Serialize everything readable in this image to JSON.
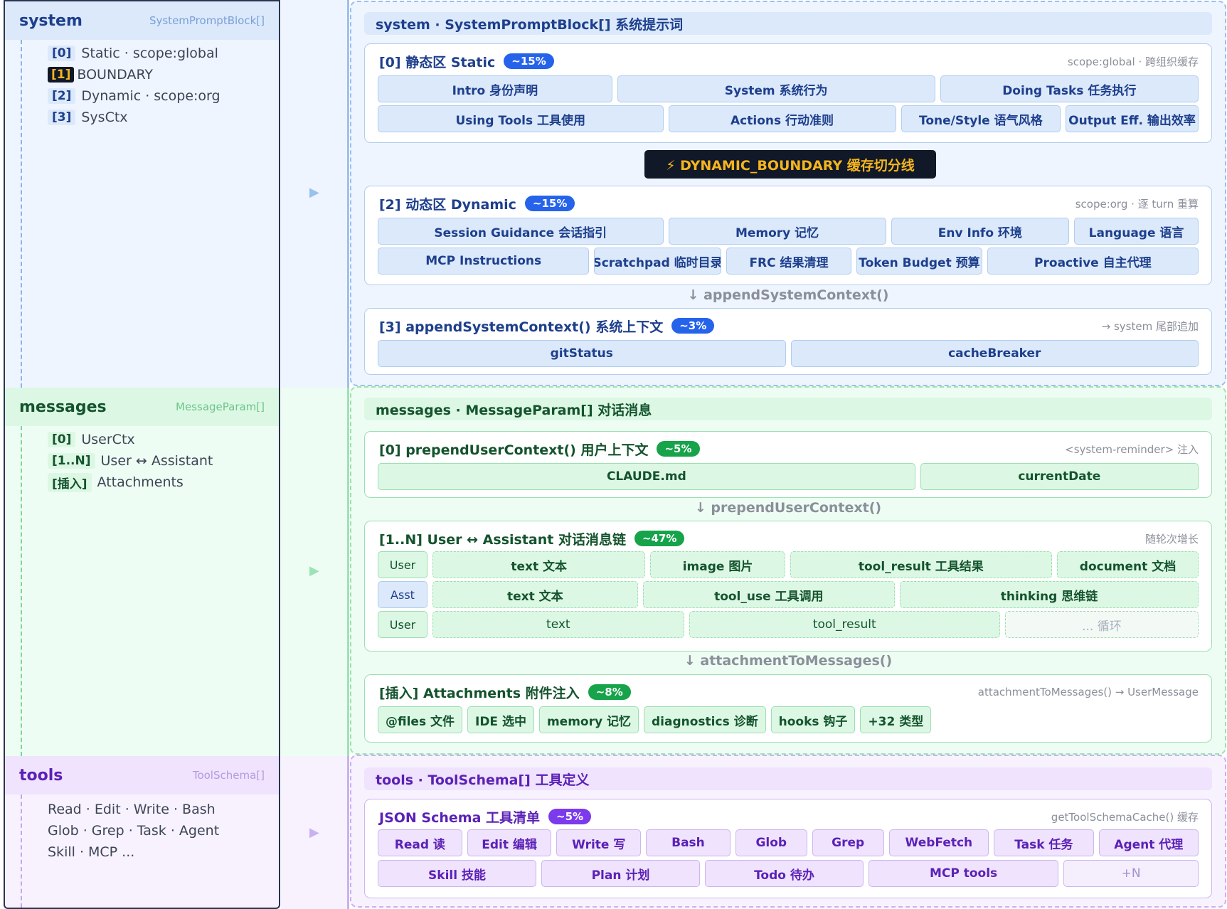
{
  "left": {
    "system": {
      "title": "system",
      "type": "SystemPromptBlock[]",
      "rows": [
        {
          "idx": "[0]",
          "text": "Static · scope:global"
        },
        {
          "idx": "[1]",
          "text": "BOUNDARY"
        },
        {
          "idx": "[2]",
          "text": "Dynamic · scope:org"
        },
        {
          "idx": "[3]",
          "text": "SysCtx"
        }
      ]
    },
    "messages": {
      "title": "messages",
      "type": "MessageParam[]",
      "rows": [
        {
          "idx": "[0]",
          "text": "UserCtx"
        },
        {
          "idx": "[1..N]",
          "text": "User ↔ Assistant"
        },
        {
          "idx": "[插入]",
          "text": "Attachments"
        }
      ]
    },
    "tools": {
      "title": "tools",
      "type": "ToolSchema[]",
      "lines": [
        "Read · Edit · Write · Bash",
        "Glob · Grep · Task · Agent",
        "Skill · MCP ..."
      ]
    }
  },
  "arrow_glyph": "▶",
  "system": {
    "title": "system · SystemPromptBlock[] 系统提示词",
    "static": {
      "title": "[0] 静态区 Static",
      "badge": "~15%",
      "note": "scope:global · 跨组织缓存",
      "row1": [
        "Intro 身份声明",
        "System 系统行为",
        "Doing Tasks 任务执行"
      ],
      "row2": [
        "Using Tools 工具使用",
        "Actions 行动准则",
        "Tone/Style 语气风格",
        "Output Eff. 输出效率"
      ]
    },
    "boundary": "⚡ DYNAMIC_BOUNDARY 缓存切分线",
    "dynamic": {
      "title": "[2] 动态区 Dynamic",
      "badge": "~15%",
      "note": "scope:org · 逐 turn 重算",
      "row1": [
        "Session Guidance 会话指引",
        "Memory 记忆",
        "Env Info 环境",
        "Language 语言"
      ],
      "row2": [
        "MCP Instructions",
        "Scratchpad 临时目录",
        "FRC 结果清理",
        "Token Budget 预算",
        "Proactive 自主代理"
      ]
    },
    "connector": "↓ appendSystemContext()",
    "sysctx": {
      "title": "[3] appendSystemContext() 系统上下文",
      "badge": "~3%",
      "note": "→ system 尾部追加",
      "items": [
        "gitStatus",
        "cacheBreaker"
      ]
    }
  },
  "messages": {
    "title": "messages · MessageParam[] 对话消息",
    "userctx": {
      "title": "[0] prependUserContext() 用户上下文",
      "badge": "~5%",
      "note": "<system-reminder> 注入",
      "items": [
        "CLAUDE.md",
        "currentDate"
      ]
    },
    "connector1": "↓ prependUserContext()",
    "chain": {
      "title": "[1..N] User ↔ Assistant 对话消息链",
      "badge": "~47%",
      "note": "随轮次增长",
      "row1": {
        "role": "User",
        "items": [
          "text 文本",
          "image 图片",
          "tool_result 工具结果",
          "document 文档"
        ]
      },
      "row2": {
        "role": "Asst",
        "items": [
          "text 文本",
          "tool_use 工具调用",
          "thinking 思维链"
        ]
      },
      "row3": {
        "role": "User",
        "items": [
          "text",
          "tool_result",
          "... 循环"
        ]
      }
    },
    "connector2": "↓ attachmentToMessages()",
    "attach": {
      "title": "[插入] Attachments 附件注入",
      "badge": "~8%",
      "note": "attachmentToMessages() → UserMessage",
      "items": [
        "@files 文件",
        "IDE 选中",
        "memory 记忆",
        "diagnostics 诊断",
        "hooks 钩子",
        "+32 类型"
      ]
    }
  },
  "tools": {
    "title": "tools · ToolSchema[] 工具定义",
    "schema": {
      "title": "JSON Schema 工具清单",
      "badge": "~5%",
      "note": "getToolSchemaCache() 缓存",
      "row1": [
        "Read 读",
        "Edit 编辑",
        "Write 写",
        "Bash",
        "Glob",
        "Grep",
        "WebFetch",
        "Task 任务",
        "Agent 代理"
      ],
      "row2": [
        "Skill 技能",
        "Plan 计划",
        "Todo 待办",
        "MCP tools",
        "+N"
      ]
    }
  },
  "colors": {
    "system_bg": "#eef5ff",
    "system_accent": "#1e3f8c",
    "system_badge": "#2563eb",
    "messages_bg": "#eefdf3",
    "messages_accent": "#14532d",
    "messages_badge": "#16a34a",
    "tools_bg": "#f8f2ff",
    "tools_accent": "#5b21b6",
    "tools_badge": "#7c3aed",
    "boundary_bg": "#111827",
    "boundary_text": "#f5b51e"
  }
}
